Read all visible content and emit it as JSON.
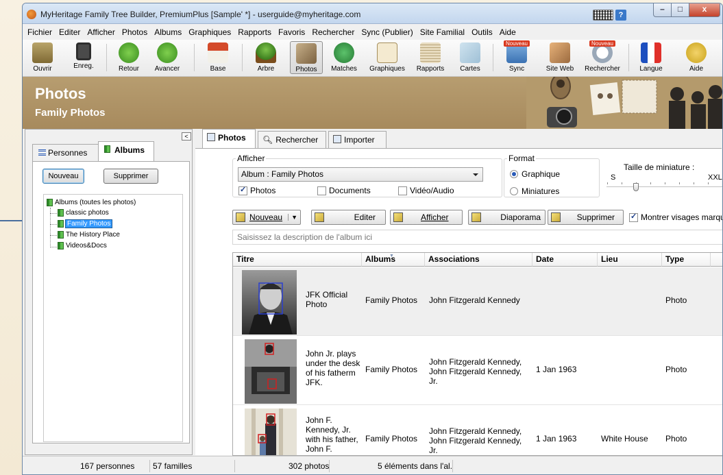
{
  "window": {
    "title": "MyHeritage Family Tree Builder, PremiumPlus [Sample' *] - userguide@myheritage.com",
    "help_label": "?",
    "minimize_label": "–",
    "maximize_label": "□",
    "close_label": "x"
  },
  "menu": [
    "Fichier",
    "Editer",
    "Afficher",
    "Photos",
    "Albums",
    "Graphiques",
    "Rapports",
    "Favoris",
    "Rechercher",
    "Sync (Publier)",
    "Site Familial",
    "Outils",
    "Aide"
  ],
  "toolbar": {
    "open": "Ouvrir",
    "save": "Enreg.",
    "back": "Retour",
    "forward": "Avancer",
    "home": "Base",
    "tree": "Arbre",
    "photos": "Photos",
    "matches": "Matches",
    "charts": "Graphiques",
    "reports": "Rapports",
    "maps": "Cartes",
    "sync": "Sync",
    "website": "Site Web",
    "search": "Rechercher",
    "language": "Langue",
    "help": "Aide",
    "new_badge": "Nouveau"
  },
  "banner": {
    "title": "Photos",
    "subtitle": "Family Photos"
  },
  "left_panel": {
    "collapse_label": "<",
    "tabs": [
      "Personnes",
      "Albums"
    ],
    "new_button": "Nouveau",
    "delete_button": "Supprimer",
    "tree_root": "Albums (toutes les photos)",
    "albums": [
      "classic photos",
      "Family Photos",
      "The History Place",
      "Videos&Docs"
    ]
  },
  "right_panel": {
    "tabs": [
      "Photos",
      "Rechercher",
      "Importer"
    ],
    "show_group": {
      "legend": "Afficher",
      "album_select": "Album : Family Photos",
      "photos_label": "Photos",
      "photos_checked": true,
      "documents_label": "Documents",
      "documents_checked": false,
      "video_label": "Vidéo/Audio",
      "video_checked": false
    },
    "format_group": {
      "legend": "Format",
      "graphic_label": "Graphique",
      "graphic_selected": true,
      "thumbnails_label": "Miniatures",
      "thumbnails_selected": false,
      "size_label": "Taille de miniature :",
      "size_min": "S",
      "size_max": "XXL",
      "size_level": 0.25
    },
    "actions": {
      "new": "Nouveau",
      "edit": "Editer",
      "view": "Afficher",
      "slideshow": "Diaporama",
      "delete": "Supprimer",
      "show_faces": "Montrer visages marqué",
      "show_faces_checked": true
    },
    "description_placeholder": "Saisissez la description de l'album ici",
    "grid": {
      "columns": [
        "Titre",
        "Albums",
        "Associations",
        "Date",
        "Lieu",
        "Type"
      ],
      "rows": [
        {
          "title": "JFK Official Photo",
          "albums": "Family Photos",
          "associations": "John Fitzgerald Kennedy",
          "date": "",
          "place": "",
          "type": "Photo"
        },
        {
          "title": "John Jr. plays under the desk of his fatherm JFK.",
          "albums": "Family Photos",
          "associations": "John Fitzgerald Kennedy, John Fitzgerald Kennedy, Jr.",
          "date": "1 Jan 1963",
          "place": "",
          "type": "Photo"
        },
        {
          "title": "John F. Kennedy, Jr. with his father, John F. Kennedy",
          "albums": "Family Photos",
          "associations": "John Fitzgerald Kennedy, John Fitzgerald Kennedy, Jr.",
          "date": "1 Jan 1963",
          "place": "White House",
          "type": "Photo"
        }
      ]
    }
  },
  "status": {
    "people": "167 personnes",
    "families": "57 familles",
    "photos": "302 photos",
    "items": "5 éléments dans l'al..."
  }
}
